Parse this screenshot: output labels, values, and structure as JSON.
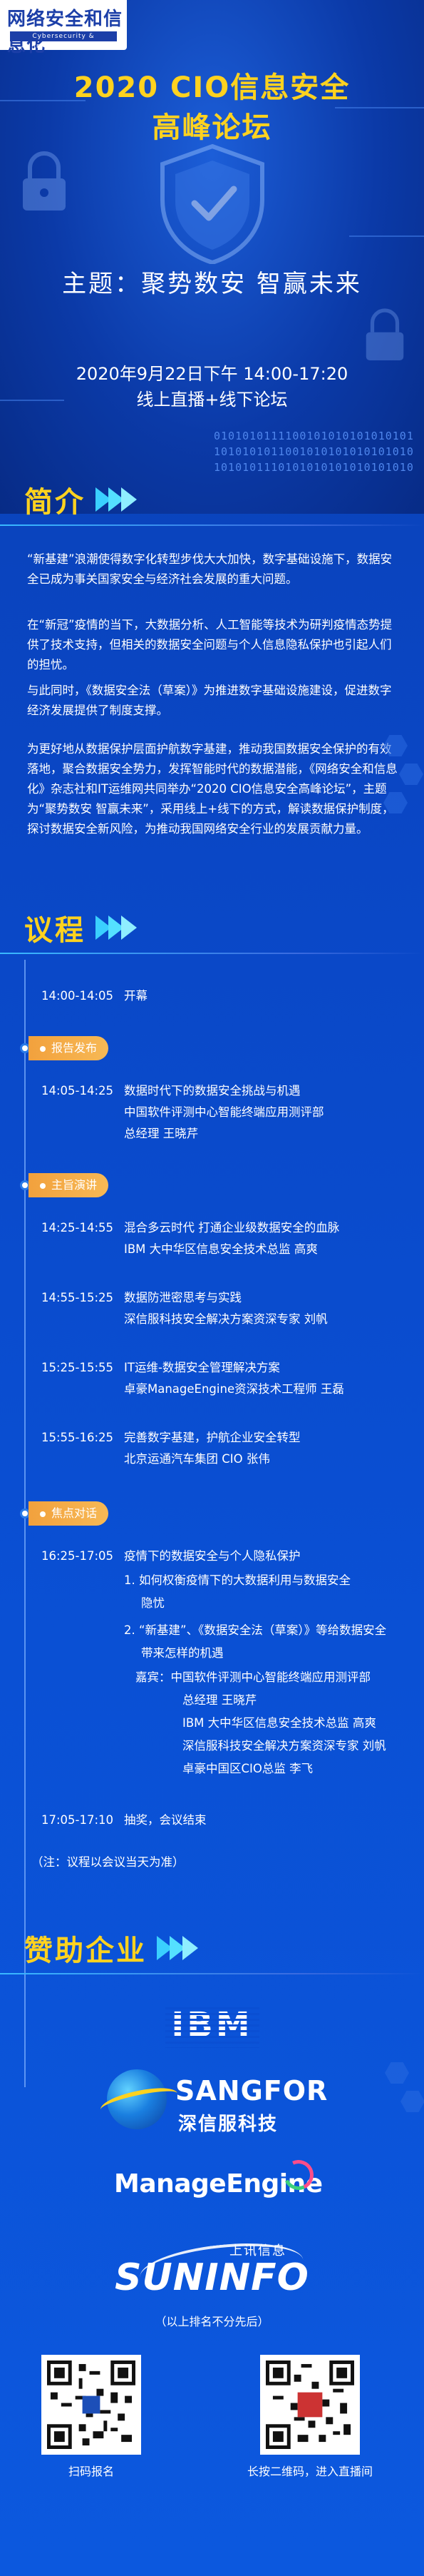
{
  "header": {
    "logo_title": "网络安全和信息化",
    "logo_subtitle": "Cybersecurity & Informatization",
    "title_line1": "2020 CIO信息安全",
    "title_line2": "高峰论坛",
    "theme": "主题：聚势数安 智赢未来",
    "date": "2020年9月22日下午 14:00-17:20",
    "format": "线上直播+线下论坛",
    "binary": [
      "0101010111100101010101010101010",
      "1010101011001010101010101010101",
      "1010101110101010101010101010101010"
    ]
  },
  "intro": {
    "title": "简介",
    "paragraphs": [
      "“新基建”浪潮使得数字化转型步伐大大加快，数字基础设施下，数据安全已成为事关国家安全与经济社会发展的重大问题。",
      "在“新冠”疫情的当下，大数据分析、人工智能等技术为研判疫情态势提供了技术支持，但相关的数据安全问题与个人信息隐私保护也引起人们的担忧。",
      "与此同时，《数据安全法（草案）》为推进数字基础设施建设，促进数字经济发展提供了制度支撑。",
      "为更好地从数据保护层面护航数字基建，推动我国数据安全保护的有效落地，聚合数据安全势力，发挥智能时代的数据潜能，《网络安全和信息化》杂志社和IT运维网共同举办“2020 CIO信息安全高峰论坛”，主题为“聚势数安 智赢未来”，采用线上+线下的方式，解读数据保护制度，探讨数据安全新风险，为推动我国网络安全行业的发展贡献力量。"
    ]
  },
  "agenda": {
    "title": "议程",
    "opening": {
      "time": "14:00-14:05",
      "text": "开幕"
    },
    "tags": [
      "报告发布",
      "主旨演讲",
      "焦点对话"
    ],
    "report": {
      "time": "14:05-14:25",
      "lines": [
        "数据时代下的数据安全挑战与机遇",
        "中国软件评测中心智能终端应用测评部",
        "总经理  王晓芹"
      ]
    },
    "speeches": [
      {
        "time": "14:25-14:55",
        "lines": [
          "混合多云时代 打通企业级数据安全的血脉",
          "IBM 大中华区信息安全技术总监  高爽"
        ]
      },
      {
        "time": "14:55-15:25",
        "lines": [
          "数据防泄密思考与实践",
          "深信服科技安全解决方案资深专家  刘帆"
        ]
      },
      {
        "time": "15:25-15:55",
        "lines": [
          "IT运维-数据安全管理解决方案",
          "卓豪ManageEngine资深技术工程师  王磊"
        ]
      },
      {
        "time": "15:55-16:25",
        "lines": [
          "完善数字基建，护航企业安全转型",
          "北京运通汽车集团 CIO  张伟"
        ]
      }
    ],
    "dialogue": {
      "time": "16:25-17:05",
      "topic": "疫情下的数据安全与个人隐私保护",
      "q1a": "1. 如何权衡疫情下的大数据利用与数据安全",
      "q1b": "隐忧",
      "q2a": "2. “新基建”、《数据安全法（草案）》等给数据安全",
      "q2b": "带来怎样的机遇",
      "guests_label": "嘉宾：中国软件评测中心智能终端应用测评部",
      "guests": [
        "总经理  王晓芹",
        "IBM 大中华区信息安全技术总监  高爽",
        "深信服科技安全解决方案资深专家  刘帆",
        "卓豪中国区CIO总监 李飞"
      ]
    },
    "closing": {
      "time": "17:05-17:10",
      "text": "抽奖，会议结束"
    },
    "note": "（注：议程以会议当天为准）"
  },
  "sponsors": {
    "title": "赞助企业",
    "ibm": "IBM",
    "sangfor": "SANGFOR",
    "sangfor_cn": "深信服科技",
    "manageengine": "ManageEngine",
    "suninfo_cn": "上讯信息",
    "suninfo": "SUNINFO",
    "note": "（以上排名不分先后）"
  },
  "qr": {
    "left_caption": "扫码报名",
    "right_caption": "长按二维码，进入直播间"
  },
  "colors": {
    "accent": "#ffd21f",
    "tag": "#f2a13d",
    "arrow": "#3ad0ff",
    "bg": "#0a46c4"
  }
}
